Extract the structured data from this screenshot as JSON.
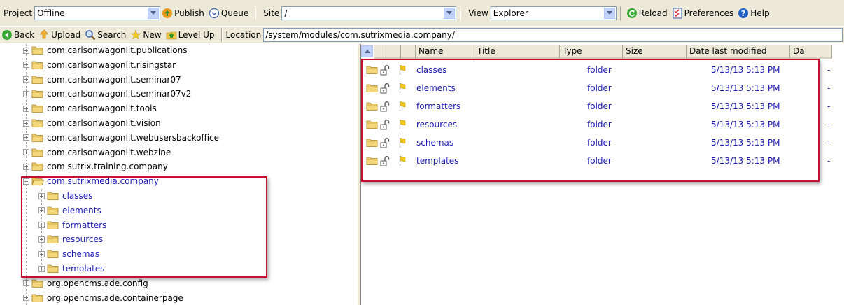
{
  "toolbar1": {
    "project_label": "Project",
    "project_value": "Offline",
    "publish_label": "Publish",
    "queue_label": "Queue",
    "site_label": "Site",
    "site_value": "/",
    "view_label": "View",
    "view_value": "Explorer",
    "reload_label": "Reload",
    "preferences_label": "Preferences",
    "help_label": "Help"
  },
  "toolbar2": {
    "back_label": "Back",
    "upload_label": "Upload",
    "search_label": "Search",
    "new_label": "New",
    "levelup_label": "Level Up",
    "location_label": "Location",
    "location_value": "/system/modules/com.sutrixmedia.company/"
  },
  "tree": {
    "items": [
      "com.carlsonwagonlit.publications",
      "com.carlsonwagonlit.risingstar",
      "com.carlsonwagonlit.seminar07",
      "com.carlsonwagonlit.seminar07v2",
      "com.carlsonwagonlit.tools",
      "com.carlsonwagonlit.vision",
      "com.carlsonwagonlit.webusersbackoffice",
      "com.carlsonwagonlit.webzine",
      "com.sutrix.training.company",
      "com.sutrixmedia.company"
    ],
    "children": [
      "classes",
      "elements",
      "formatters",
      "resources",
      "schemas",
      "templates"
    ],
    "after": [
      "org.opencms.ade.config",
      "org.opencms.ade.containerpage"
    ]
  },
  "list": {
    "columns": [
      "Name",
      "Title",
      "Type",
      "Size",
      "Date last modified",
      "Da"
    ],
    "rows": [
      {
        "name": "classes",
        "type": "folder",
        "date": "5/13/13 5:13 PM",
        "extra": "-"
      },
      {
        "name": "elements",
        "type": "folder",
        "date": "5/13/13 5:13 PM",
        "extra": "-"
      },
      {
        "name": "formatters",
        "type": "folder",
        "date": "5/13/13 5:13 PM",
        "extra": "-"
      },
      {
        "name": "resources",
        "type": "folder",
        "date": "5/13/13 5:13 PM",
        "extra": "-"
      },
      {
        "name": "schemas",
        "type": "folder",
        "date": "5/13/13 5:13 PM",
        "extra": "-"
      },
      {
        "name": "templates",
        "type": "folder",
        "date": "5/13/13 5:13 PM",
        "extra": "-"
      }
    ]
  },
  "colors": {
    "toolbar_bg": "#ece9d8",
    "link_blue": "#1c1cb0",
    "highlight_red": "#c8102e"
  }
}
